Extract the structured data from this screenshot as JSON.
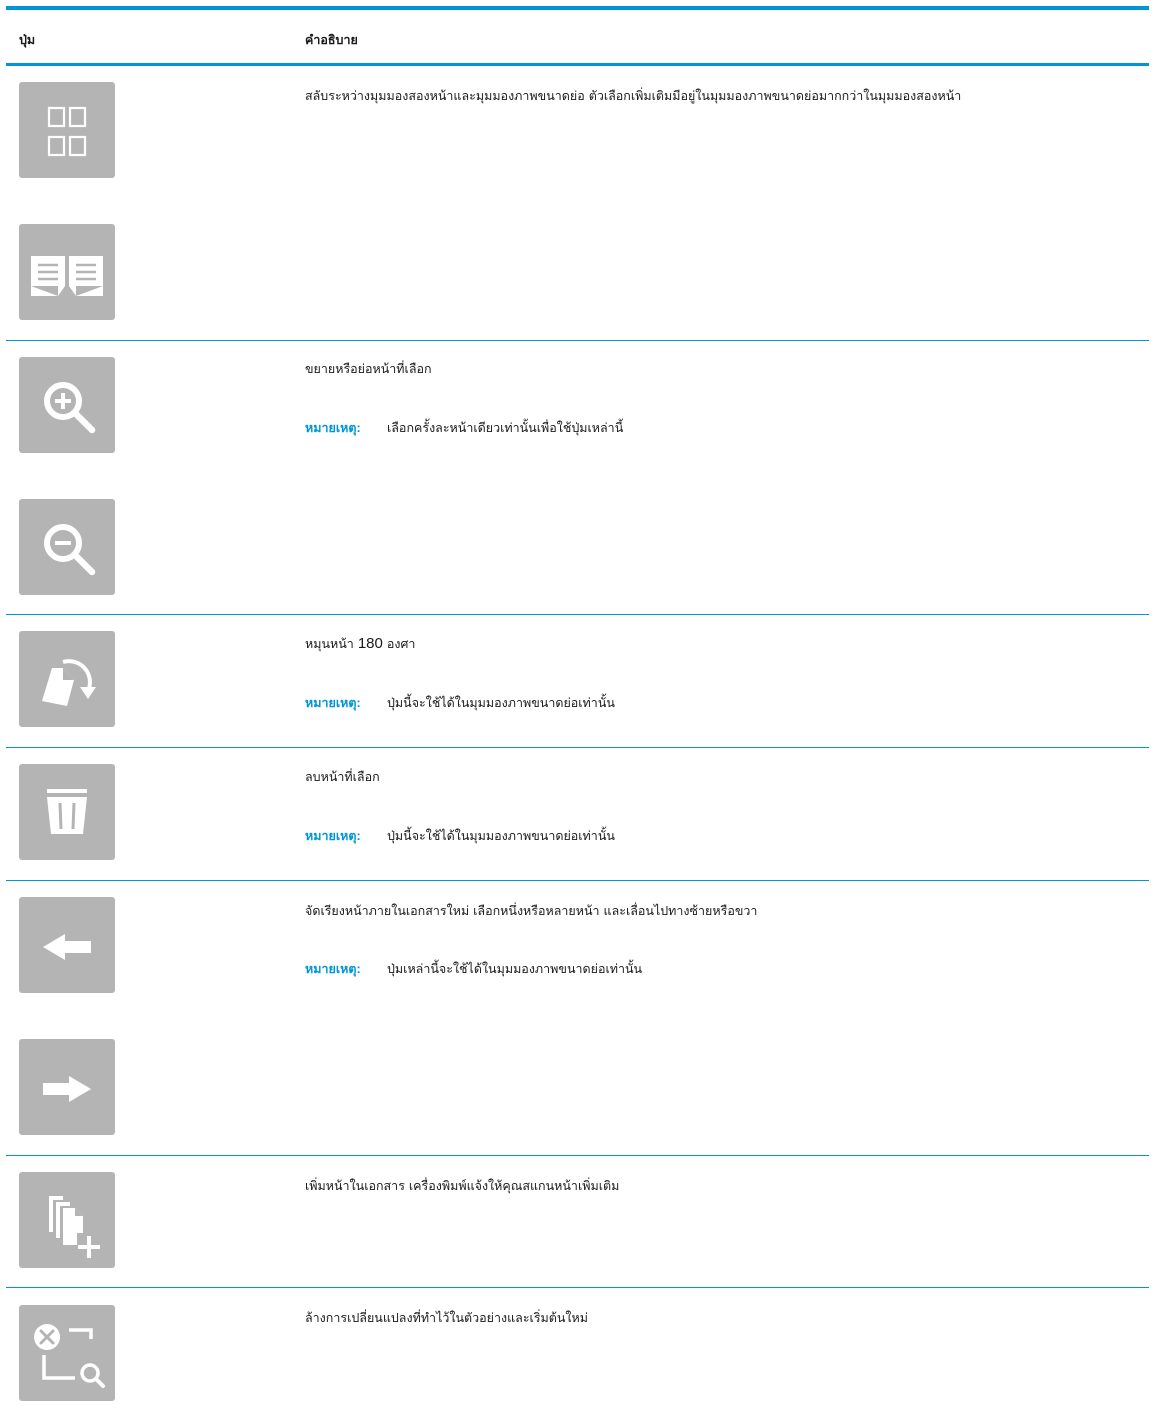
{
  "header": {
    "col_button": "ปุ่ม",
    "col_description": "คำอธิบาย"
  },
  "note_label": "หมายเหตุ",
  "rows": [
    {
      "buttons": [
        "grid-view",
        "two-page-view"
      ],
      "description": "สลับระหว่างมุมมองสองหน้าและมุมมองภาพขนาดย่อ ตัวเลือกเพิ่มเติมมีอยู่ในมุมมองภาพขนาดย่อมากกว่าในมุมมองสองหน้า"
    },
    {
      "buttons": [
        "zoom-in",
        "zoom-out"
      ],
      "description": "ขยายหรือย่อหน้าที่เลือก",
      "note": "เลือกครั้งละหน้าเดียวเท่านั้นเพื่อใช้ปุ่มเหล่านี้"
    },
    {
      "buttons": [
        "rotate-page"
      ],
      "description_before": "หมุนหน้า",
      "description_number": "180",
      "description_after": "องศา",
      "note": "ปุ่มนี้จะใช้ได้ในมุมมองภาพขนาดย่อเท่านั้น"
    },
    {
      "buttons": [
        "delete"
      ],
      "description": "ลบหน้าที่เลือก",
      "note": "ปุ่มนี้จะใช้ได้ในมุมมองภาพขนาดย่อเท่านั้น"
    },
    {
      "buttons": [
        "move-left",
        "move-right"
      ],
      "description": "จัดเรียงหน้าภายในเอกสารใหม่ เลือกหนึ่งหรือหลายหน้า และเลื่อนไปทางซ้ายหรือขวา",
      "note": "ปุ่มเหล่านี้จะใช้ได้ในมุมมองภาพขนาดย่อเท่านั้น"
    },
    {
      "buttons": [
        "add-page"
      ],
      "description": "เพิ่มหน้าในเอกสาร เครื่องพิมพ์แจ้งให้คุณสแกนหน้าเพิ่มเติม"
    },
    {
      "buttons": [
        "reset-preview"
      ],
      "description": "ล้างการเปลี่ยนแปลงที่ทำไว้ในตัวอย่างและเริ่มต้นใหม่"
    }
  ],
  "colors": {
    "accent": "#0096d6",
    "button_bg": "#b4b4b4",
    "icon": "#ffffff"
  }
}
